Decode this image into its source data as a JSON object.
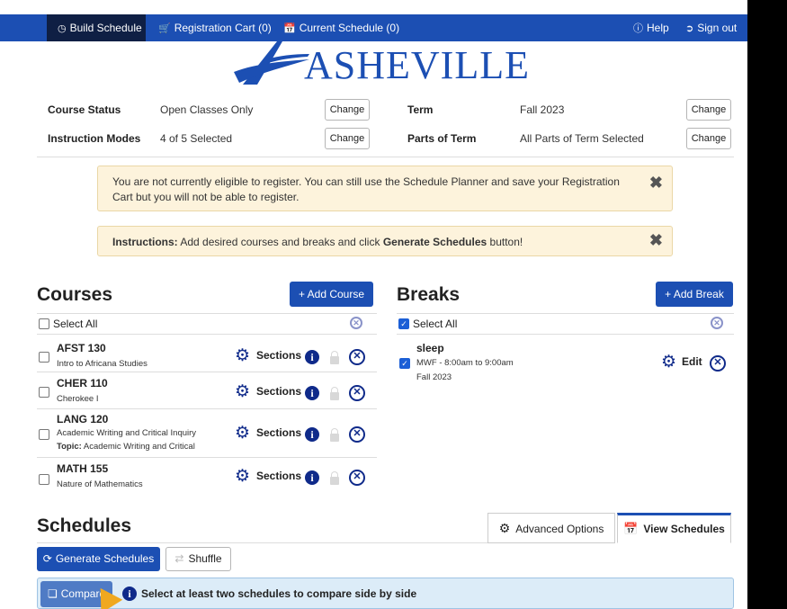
{
  "nav": {
    "build_schedule": "Build Schedule",
    "registration_cart": "Registration Cart (0)",
    "current_schedule": "Current Schedule (0)",
    "help": "Help",
    "sign_out": "Sign out"
  },
  "logo": {
    "text": "ASHEVILLE"
  },
  "settings": {
    "course_status_label": "Course Status",
    "course_status_value": "Open Classes Only",
    "instruction_modes_label": "Instruction Modes",
    "instruction_modes_value": "4 of 5 Selected",
    "term_label": "Term",
    "term_value": "Fall 2023",
    "parts_of_term_label": "Parts of Term",
    "parts_of_term_value": "All Parts of Term Selected",
    "change_label": "Change"
  },
  "alerts": {
    "eligibility_line1": "You are not currently eligible to register. You can still use the Schedule Planner and save your Registration",
    "eligibility_line2": "Cart but you will not be able to register.",
    "instructions_bold": "Instructions:",
    "instructions_text": " Add desired courses and breaks and click ",
    "instructions_button_name": "Generate Schedules",
    "instructions_tail": " button!"
  },
  "courses": {
    "title": "Courses",
    "add_label": "+ Add Course",
    "select_all": "Select All",
    "sections_label": "Sections",
    "items": [
      {
        "code": "AFST 130",
        "name": "Intro to Africana Studies"
      },
      {
        "code": "CHER 110",
        "name": "Cherokee I"
      },
      {
        "code": "LANG 120",
        "name": "Academic Writing and Critical Inquiry",
        "topic_label": "Topic:",
        "topic": " Academic Writing and Critical"
      },
      {
        "code": "MATH 155",
        "name": "Nature of Mathematics"
      }
    ]
  },
  "breaks": {
    "title": "Breaks",
    "add_label": "+ Add Break",
    "select_all": "Select All",
    "edit_label": "Edit",
    "items": [
      {
        "name": "sleep",
        "time": "MWF - 8:00am to 9:00am",
        "term": "Fall 2023"
      }
    ]
  },
  "schedules": {
    "title": "Schedules",
    "advanced_options": "Advanced Options",
    "view_schedules": "View Schedules",
    "generate_label": "Generate Schedules",
    "shuffle_label": "Shuffle",
    "compare_label": "Compare",
    "compare_hint": "Select at least two schedules to compare side by side"
  },
  "colors": {
    "nav_bg": "#1c4fb3",
    "nav_active_bg": "#0f1f44",
    "primary": "#1c4fb3",
    "alert_bg": "#fdf3dc",
    "info_bar_bg": "#dcecf8",
    "icon_dark": "#0f2a8a"
  }
}
